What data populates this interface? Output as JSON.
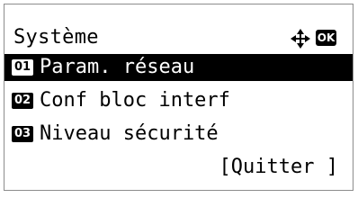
{
  "header": {
    "title": "Système",
    "nav_icon": "four-way-arrow-icon",
    "ok_label": "OK"
  },
  "menu": {
    "items": [
      {
        "number": "01",
        "label": "Param. réseau",
        "selected": true
      },
      {
        "number": "02",
        "label": "Conf bloc interf",
        "selected": false
      },
      {
        "number": "03",
        "label": "Niveau sécurité",
        "selected": false
      }
    ]
  },
  "footer": {
    "quit_label": "[Quitter ]"
  },
  "colors": {
    "background": "#ffffff",
    "foreground": "#000000",
    "border": "#8c8c8c"
  }
}
